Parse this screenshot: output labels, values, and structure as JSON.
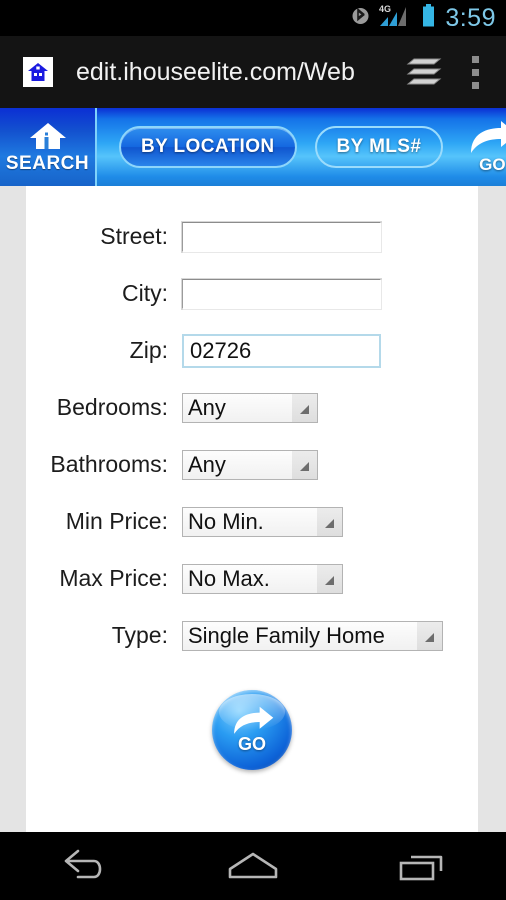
{
  "statusbar": {
    "time": "3:59",
    "icons": [
      "bluetooth-icon",
      "signal-4g-icon",
      "battery-icon"
    ],
    "network_label": "4G"
  },
  "browser": {
    "url": "edit.ihouseelite.com/Web",
    "favicon_name": "house-favicon",
    "tabs_button_label": "tabs-icon",
    "menu_button_label": "overflow-menu-icon"
  },
  "site_header": {
    "search_label": "SEARCH",
    "tabs": [
      {
        "label": "BY LOCATION",
        "active": true
      },
      {
        "label": "BY MLS#",
        "active": false
      }
    ],
    "go_label": "GO"
  },
  "form": {
    "fields": [
      {
        "label": "Street:",
        "type": "text",
        "value": "",
        "placeholder": ""
      },
      {
        "label": "City:",
        "type": "text",
        "value": "",
        "placeholder": ""
      },
      {
        "label": "Zip:",
        "type": "text",
        "value": "02726",
        "placeholder": "",
        "focused": true
      },
      {
        "label": "Bedrooms:",
        "type": "select",
        "value": "Any"
      },
      {
        "label": "Bathrooms:",
        "type": "select",
        "value": "Any"
      },
      {
        "label": "Min Price:",
        "type": "select",
        "value": "No Min."
      },
      {
        "label": "Max Price:",
        "type": "select",
        "value": "No Max."
      },
      {
        "label": "Type:",
        "type": "select",
        "value": "Single Family Home"
      }
    ],
    "submit_label": "GO"
  },
  "navbar": {
    "buttons": [
      {
        "name": "back-icon"
      },
      {
        "name": "home-icon"
      },
      {
        "name": "recents-icon"
      }
    ]
  },
  "colors": {
    "status_time": "#7ec8e8",
    "header_blue": "#1f8ce8",
    "focus_border": "#b4d9ea",
    "page_background": "#e4e4e4",
    "sheet_background": "#ffffff"
  }
}
